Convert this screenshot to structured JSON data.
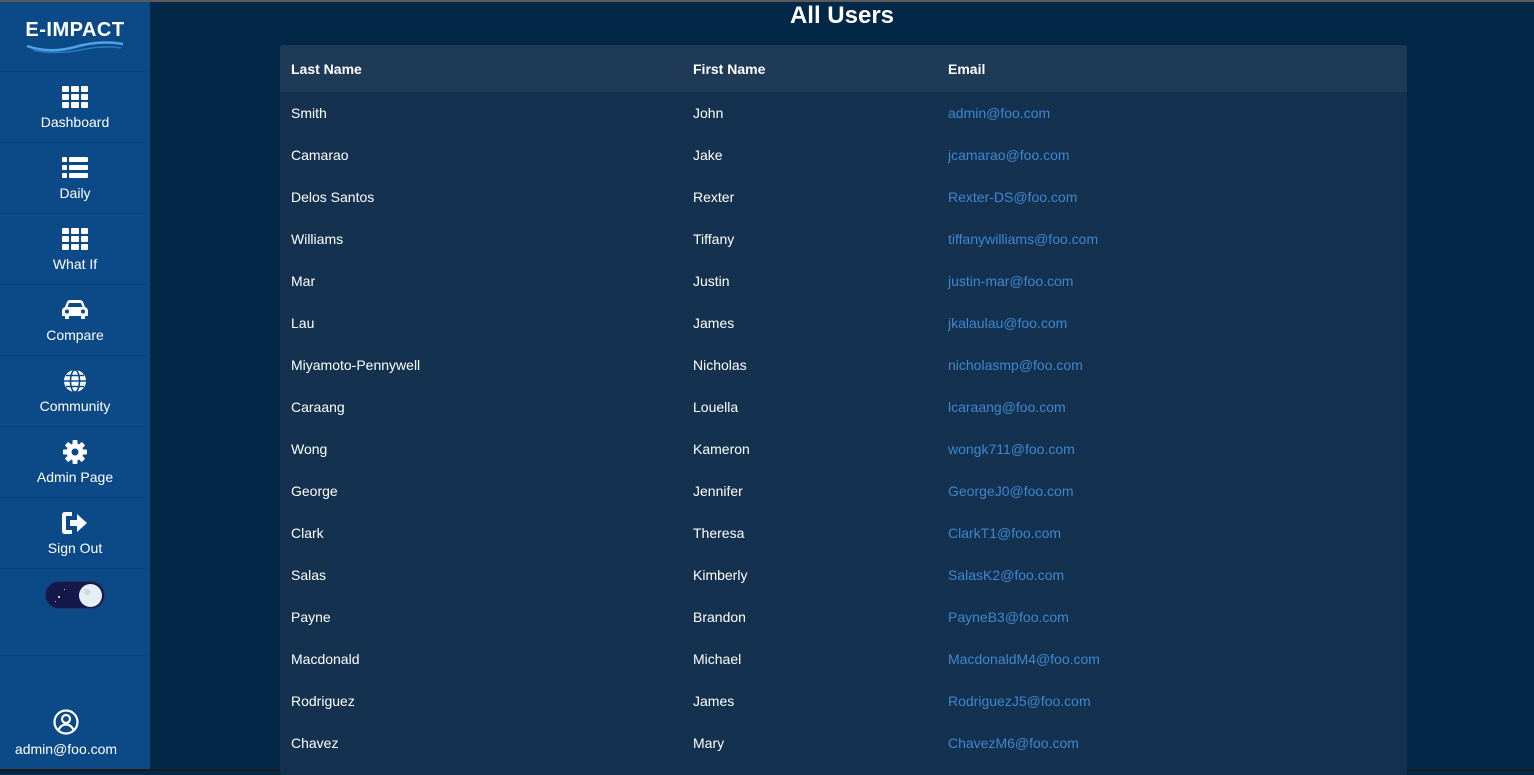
{
  "app": {
    "logo_text": "E-IMPACT"
  },
  "sidebar": {
    "items": [
      {
        "label": "Dashboard",
        "icon": "grid-icon"
      },
      {
        "label": "Daily",
        "icon": "list-icon"
      },
      {
        "label": "What If",
        "icon": "grid-icon"
      },
      {
        "label": "Compare",
        "icon": "car-icon"
      },
      {
        "label": "Community",
        "icon": "globe-icon"
      },
      {
        "label": "Admin Page",
        "icon": "gear-icon"
      },
      {
        "label": "Sign Out",
        "icon": "sign-out-icon"
      }
    ],
    "theme_toggle": {
      "state": "dark"
    },
    "user": {
      "email": "admin@foo.com",
      "icon": "user-circle-icon"
    }
  },
  "main": {
    "title": "All Users",
    "table": {
      "headers": [
        "Last Name",
        "First Name",
        "Email"
      ],
      "rows": [
        [
          "Smith",
          "John",
          "admin@foo.com"
        ],
        [
          "Camarao",
          "Jake",
          "jcamarao@foo.com"
        ],
        [
          "Delos Santos",
          "Rexter",
          "Rexter-DS@foo.com"
        ],
        [
          "Williams",
          "Tiffany",
          "tiffanywilliams@foo.com"
        ],
        [
          "Mar",
          "Justin",
          "justin-mar@foo.com"
        ],
        [
          "Lau",
          "James",
          "jkalaulau@foo.com"
        ],
        [
          "Miyamoto-Pennywell",
          "Nicholas",
          "nicholasmp@foo.com"
        ],
        [
          "Caraang",
          "Louella",
          "lcaraang@foo.com"
        ],
        [
          "Wong",
          "Kameron",
          "wongk711@foo.com"
        ],
        [
          "George",
          "Jennifer",
          "GeorgeJ0@foo.com"
        ],
        [
          "Clark",
          "Theresa",
          "ClarkT1@foo.com"
        ],
        [
          "Salas",
          "Kimberly",
          "SalasK2@foo.com"
        ],
        [
          "Payne",
          "Brandon",
          "PayneB3@foo.com"
        ],
        [
          "Macdonald",
          "Michael",
          "MacdonaldM4@foo.com"
        ],
        [
          "Rodriguez",
          "James",
          "RodriguezJ5@foo.com"
        ],
        [
          "Chavez",
          "Mary",
          "ChavezM6@foo.com"
        ]
      ]
    }
  },
  "colors": {
    "sidebar_bg": "#0b4a86",
    "page_bg": "#032747",
    "table_bg": "#14324f",
    "header_bg": "#1e3a57",
    "email_link": "#3f86d0"
  }
}
